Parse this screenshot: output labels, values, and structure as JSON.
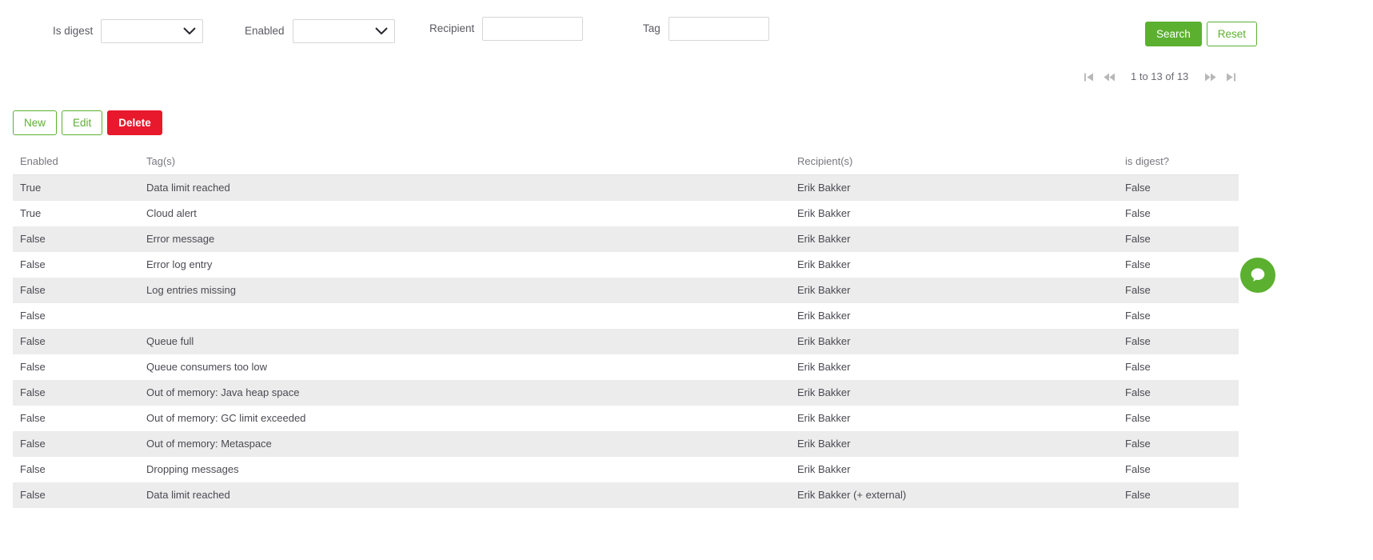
{
  "filters": {
    "is_digest": {
      "label": "Is digest",
      "value": "",
      "placeholder": ""
    },
    "enabled": {
      "label": "Enabled",
      "value": "",
      "placeholder": ""
    },
    "recipient": {
      "label": "Recipient",
      "value": "",
      "placeholder": ""
    },
    "tag": {
      "label": "Tag",
      "value": "",
      "placeholder": ""
    },
    "search_label": "Search",
    "reset_label": "Reset"
  },
  "pagination": {
    "first_icon": "first-page-icon",
    "prev_icon": "previous-page-icon",
    "next_icon": "next-page-icon",
    "last_icon": "last-page-icon",
    "summary": "1 to 13 of 13"
  },
  "crud": {
    "new_label": "New",
    "edit_label": "Edit",
    "delete_label": "Delete"
  },
  "table": {
    "columns": [
      "Enabled",
      "Tag(s)",
      "Recipient(s)",
      "is digest?"
    ],
    "rows": [
      {
        "enabled": "True",
        "tags": "Data limit reached",
        "recipient": "Erik Bakker",
        "digest": "False"
      },
      {
        "enabled": "True",
        "tags": "Cloud alert",
        "recipient": "Erik Bakker",
        "digest": "False"
      },
      {
        "enabled": "False",
        "tags": "Error message",
        "recipient": "Erik Bakker",
        "digest": "False"
      },
      {
        "enabled": "False",
        "tags": "Error log entry",
        "recipient": "Erik Bakker",
        "digest": "False"
      },
      {
        "enabled": "False",
        "tags": "Log entries missing",
        "recipient": "Erik Bakker",
        "digest": "False"
      },
      {
        "enabled": "False",
        "tags": "",
        "recipient": "Erik Bakker",
        "digest": "False"
      },
      {
        "enabled": "False",
        "tags": "Queue full",
        "recipient": "Erik Bakker",
        "digest": "False"
      },
      {
        "enabled": "False",
        "tags": "Queue consumers too low",
        "recipient": "Erik Bakker",
        "digest": "False"
      },
      {
        "enabled": "False",
        "tags": "Out of memory: Java heap space",
        "recipient": "Erik Bakker",
        "digest": "False"
      },
      {
        "enabled": "False",
        "tags": "Out of memory: GC limit exceeded",
        "recipient": "Erik Bakker",
        "digest": "False"
      },
      {
        "enabled": "False",
        "tags": "Out of memory: Metaspace",
        "recipient": "Erik Bakker",
        "digest": "False"
      },
      {
        "enabled": "False",
        "tags": "Dropping messages",
        "recipient": "Erik Bakker",
        "digest": "False"
      },
      {
        "enabled": "False",
        "tags": "Data limit reached",
        "recipient": "Erik Bakker (+ external)",
        "digest": "False"
      }
    ]
  },
  "floating_action": {
    "icon": "help-chat-icon"
  },
  "colors": {
    "green": "#5cb030",
    "red": "#e8192c",
    "row_stripe": "#ececec",
    "text": "#4a4a52",
    "muted": "#77777f"
  }
}
